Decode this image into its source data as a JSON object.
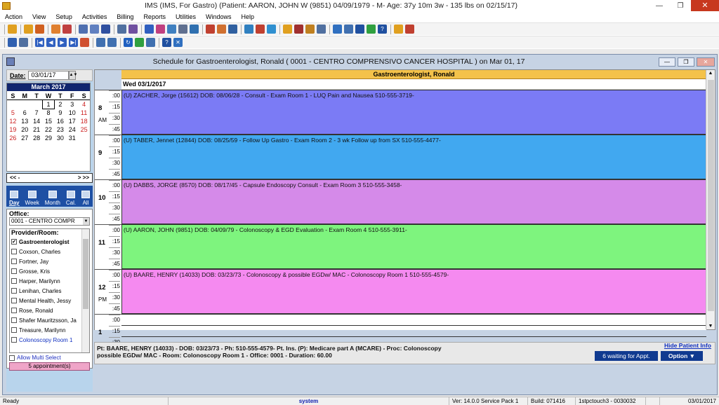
{
  "app_title": "IMS (IMS, For Gastro)     (Patient: AARON, JOHN W (9851) 04/09/1979 - M- Age: 37y 10m 3w - 135 lbs on 02/15/17)",
  "menu": [
    "Action",
    "View",
    "Setup",
    "Activities",
    "Billing",
    "Reports",
    "Utilities",
    "Windows",
    "Help"
  ],
  "schedule_window": {
    "title": "Schedule for Gastroenterologist, Ronald ( 0001 - CENTRO COMPRENSIVO CANCER HOSPITAL )  on  Mar 01, 17"
  },
  "date": {
    "label": "Date:",
    "value": "03/01/17"
  },
  "calendar": {
    "month_label": "March 2017",
    "day_names": [
      "S",
      "M",
      "T",
      "W",
      "T",
      "F",
      "S"
    ],
    "weeks": [
      [
        "",
        "",
        "",
        "1",
        "2",
        "3",
        "4"
      ],
      [
        "5",
        "6",
        "7",
        "8",
        "9",
        "10",
        "11"
      ],
      [
        "12",
        "13",
        "14",
        "15",
        "16",
        "17",
        "18"
      ],
      [
        "19",
        "20",
        "21",
        "22",
        "23",
        "24",
        "25"
      ],
      [
        "26",
        "27",
        "28",
        "29",
        "30",
        "31",
        ""
      ]
    ],
    "selected_day": "1",
    "weekend_color": "#cc2020",
    "prev": "<< -",
    "next": "> >>"
  },
  "view_buttons": [
    {
      "label": "Day",
      "icon": "day-view-icon"
    },
    {
      "label": "Week",
      "icon": "week-view-icon"
    },
    {
      "label": "Month",
      "icon": "month-view-icon"
    },
    {
      "label": "Cal.",
      "icon": "calendar-icon"
    },
    {
      "label": "All",
      "icon": "all-view-icon"
    }
  ],
  "office": {
    "label": "Office:",
    "value": "0001 - CENTRO COMPR"
  },
  "providers": {
    "header": "Provider/Room:",
    "items": [
      {
        "label": "Gastroenterologist",
        "checked": true,
        "bold": true
      },
      {
        "label": "Coxson, Charles",
        "checked": false
      },
      {
        "label": "Fortner, Jay",
        "checked": false
      },
      {
        "label": "Grosse, Kris",
        "checked": false
      },
      {
        "label": "Harper, Marilynn",
        "checked": false
      },
      {
        "label": "Lenihan, Charles",
        "checked": false
      },
      {
        "label": "Mental Health, Jessy",
        "checked": false
      },
      {
        "label": "Rose, Ronald",
        "checked": false
      },
      {
        "label": "Shafer Mauritzsson, Ja",
        "checked": false
      },
      {
        "label": "Treasure, Marilynn",
        "checked": false
      },
      {
        "label": "Colonoscopy Room 1",
        "checked": false,
        "blue": true
      }
    ]
  },
  "multi_select": "Allow Multi Select",
  "appointments_button": "5 appointment(s)",
  "schedule": {
    "provider_header": "Gastroenterologist, Ronald",
    "day_header": "Wed 03/1/2017",
    "hours": [
      {
        "hour": "8",
        "ampm": "AM"
      },
      {
        "hour": "9",
        "ampm": ""
      },
      {
        "hour": "10",
        "ampm": ""
      },
      {
        "hour": "11",
        "ampm": ""
      },
      {
        "hour": "12",
        "ampm": "PM"
      },
      {
        "hour": "1",
        "ampm": ""
      }
    ],
    "minutes": [
      ":00",
      ":15",
      ":30",
      ":45"
    ],
    "appointments": [
      {
        "text": "(U)  ZACHER, Jorge  (15612)  DOB: 08/06/28  -  Consult - Exam Room 1 - LUQ Pain and Nausea     510-555-3719-",
        "color": "#7b7bf5"
      },
      {
        "text": "(U)  TABER, Jennet  (12844)  DOB: 08/25/59  -  Follow Up Gastro  - Exam Room 2 - 3  wk Follow up from SX     510-555-4477-",
        "color": "#41a8f0"
      },
      {
        "text": "(U)  DABBS, JORGE  (8570)  DOB: 08/17/45  -  Capsule Endoscopy Consult - Exam Room 3     510-555-3458-",
        "color": "#d58ae9"
      },
      {
        "text": "(U)  AARON, JOHN  (9851)  DOB: 04/09/79  -  Colonoscopy & EGD Evaluation - Exam Room 4     510-555-3911-",
        "color": "#7ef47e"
      },
      {
        "text": "(U)  BAARE, HENRY  (14033)  DOB: 03/23/73  -  Colonoscopy & possible EGDw/ MAC - Colonoscopy Room 1     510-555-4579-",
        "color": "#f58af0"
      }
    ]
  },
  "info": {
    "line1": "Pt: BAARE, HENRY  (14033) - DOB: 03/23/73 - Ph: 510-555-4579- Pt. Ins. (P): Medicare part A (MCARE)  - Proc: Colonoscopy",
    "line2": "possible EGDw/ MAC - Room: Colonoscopy Room 1  - Office: 0001  - Duration: 60.00",
    "hide_link": "Hide Patient Info",
    "waiting": "6 waiting for Appt.",
    "option": "Option"
  },
  "status": {
    "ready": "Ready",
    "user": "system",
    "version": "Ver: 14.0.0 Service Pack 1",
    "build": "Build: 071416",
    "station": "1stpctouch3 - 0030032",
    "date": "03/01/2017"
  }
}
